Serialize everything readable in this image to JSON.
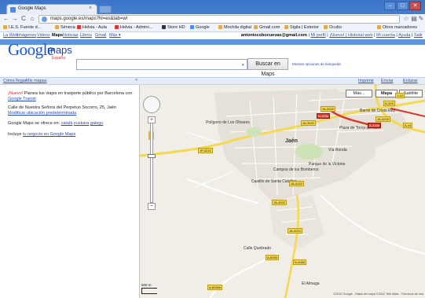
{
  "browser": {
    "tab_title": "Google Maps",
    "tab_close": "×",
    "url": "maps.google.es/maps?hl=es&tab=wl",
    "nav": {
      "back": "←",
      "forward": "→",
      "reload": "C",
      "home": "⌂"
    },
    "star": "☆",
    "window": {
      "minimize": "–",
      "maximize": "□",
      "close": "✕"
    },
    "bookmarks": [
      "I.E.S. Fuente d...",
      "Séneca",
      "Helvia - Aula",
      "Helvia - Admini...",
      "Store HD",
      "Google",
      "Mochila digital",
      "Gmail.com",
      "Sigila | Exterior",
      "Oculto"
    ],
    "other_bookmarks": "Otros marcadores"
  },
  "gbar": {
    "links": [
      "La Web",
      "Imágenes",
      "Videos",
      "Maps",
      "Noticias",
      "Libros",
      "Gmail",
      "Más ▾"
    ],
    "active": "Maps",
    "user_email": "antoniocobocuevas@gmail.com",
    "user_links": [
      "Mi perfil",
      "¡Nuevo! | Historial web",
      "Mi cuenta",
      "Ayuda",
      "Salir"
    ]
  },
  "header": {
    "logo_word": "Google",
    "logo_maps": "maps",
    "logo_country": "España",
    "search_value": "",
    "search_button": "Buscar en Maps",
    "search_options": "Mostrar opciones de búsqueda"
  },
  "strip": {
    "left_links": [
      "Cómo llegar",
      "Mis mapas"
    ],
    "collapse": "«",
    "right_links": [
      "Imprimir",
      "Enviar",
      "Enlazar"
    ]
  },
  "left_panel": {
    "promo_new": "¡Nuevo!",
    "promo_text": "Planea tus viajes en trasporte público por Barcelona con",
    "promo_link": "Google Transit",
    "location_text": "Calle de Nuestra Señora del Perpetuo Socorro, 25, Jaén",
    "location_link": "Modificar ubicación predeterminada",
    "languages_text": "Google Maps se ofrece en:",
    "languages": [
      "català",
      "euskara",
      "galego"
    ],
    "business_text": "Incluye",
    "business_link": "tu negocio en Google Maps"
  },
  "map": {
    "map_types": [
      "Más...",
      "Mapa",
      "Satélite"
    ],
    "active_type": "Mapa",
    "zoom_in": "+",
    "zoom_out": "−",
    "city": "Jaén",
    "places": [
      "Polígono de Los Olivares",
      "Plaza de Toros de Jaén",
      "Barrio de Cristo Rey",
      "Parque de la Victoria",
      "Vía Ronda",
      "Campos de los Bomberos",
      "Castillo de Santa Catalina",
      "Calle Quebrado",
      "El Almaga"
    ],
    "road_labels": [
      "JA-3200",
      "A-316",
      "JA-3002",
      "N-323a",
      "JP-3221",
      "JA-3209",
      "A-44",
      "JA-3242",
      "JA-3210",
      "A-6050",
      "N-4050",
      "A-6050b",
      "JA-4002",
      "J-14",
      "A-316b"
    ],
    "scale_text": "500 m",
    "copyright": "©2012 Google - Datos de mapa ©2012 Tele Atlas - Términos de uso"
  },
  "colors": {
    "chrome_blue": "#3b74c8",
    "link_blue": "#2a4db3",
    "highway_yellow": "#f4d94f",
    "national_road_red": "#d83a2c",
    "urban_fill": "#e6e1d8"
  }
}
